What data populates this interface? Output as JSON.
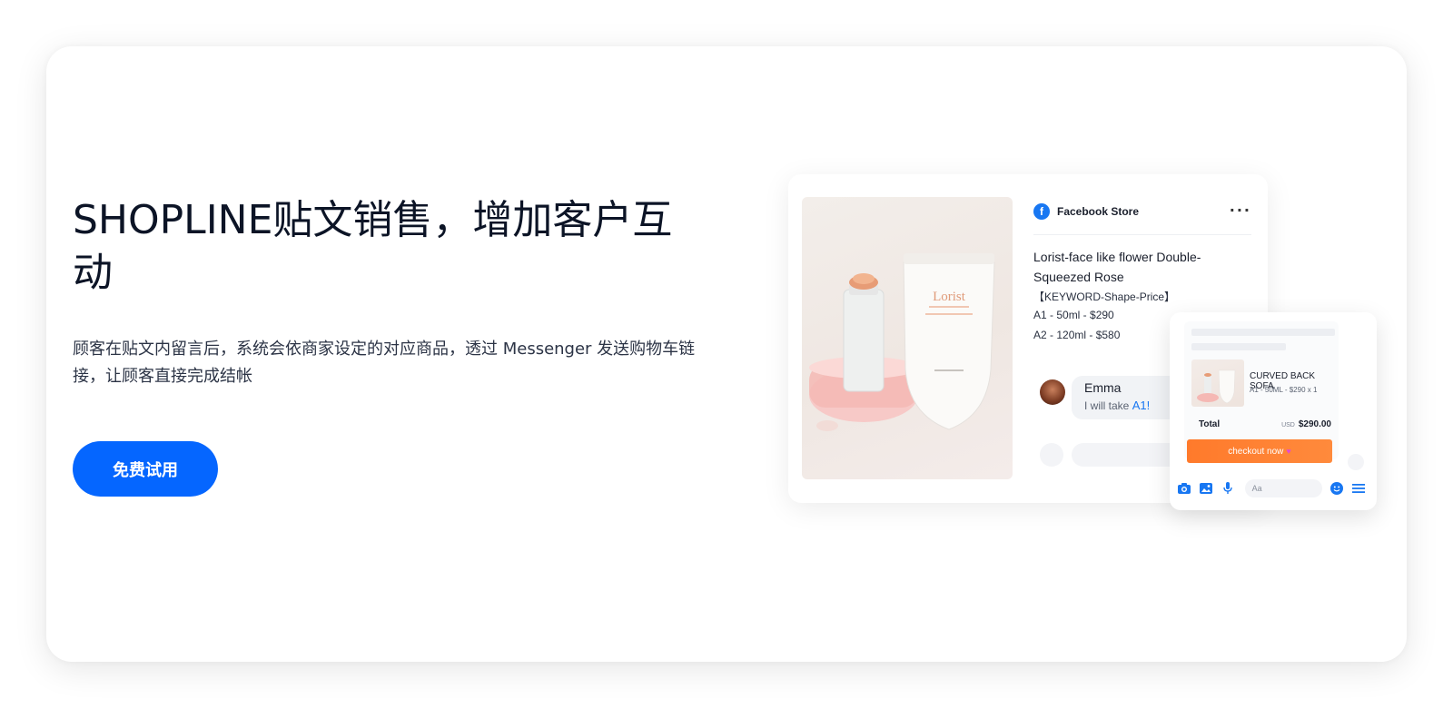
{
  "hero": {
    "title": "SHOPLINE贴文销售，增加客户互动",
    "description": "顾客在贴文内留言后，系统会依商家设定的对应商品，透过 Messenger 发送购物车链接，让顾客直接完成结帐",
    "cta_label": "免费试用"
  },
  "post": {
    "store_name": "Facebook Store",
    "product_title": "Lorist-face like flower Double-Squeezed Rose",
    "keyword_line": "【KEYWORD-Shape-Price】",
    "option_a1": "A1 - 50ml - $290",
    "option_a2": "A2 - 120ml - $580",
    "brand_label": "Lorist",
    "comment": {
      "name": "Emma",
      "text_prefix": "I will take ",
      "text_keyword": "A1!"
    }
  },
  "messenger": {
    "cart_item_name": "CURVED BACK SOFA",
    "cart_item_variant": "A1 - 50ML - $290 x 1",
    "total_label": "Total",
    "currency": "USD",
    "total_amount": "$290.00",
    "checkout_label": "checkout now",
    "input_placeholder": "Aa"
  },
  "colors": {
    "primary": "#0566ff",
    "facebook": "#1877f2",
    "checkout": "#ff7a2b"
  }
}
